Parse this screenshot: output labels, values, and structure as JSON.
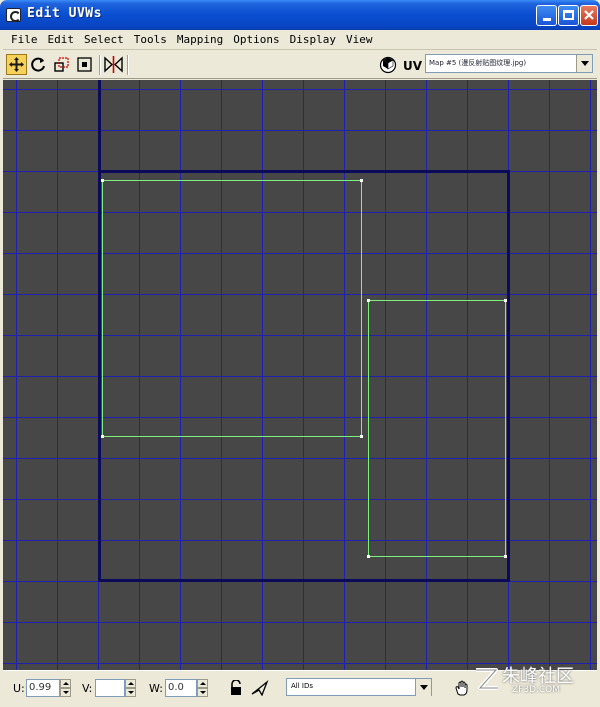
{
  "window": {
    "title": "Edit UVWs",
    "colors": {
      "titlebar": "#0a4fd0",
      "close": "#c4391b"
    }
  },
  "menu": {
    "items": [
      "File",
      "Edit",
      "Select",
      "Tools",
      "Mapping",
      "Options",
      "Display",
      "View"
    ]
  },
  "toolbar": {
    "tools": [
      "move-tool-icon",
      "rotate-tool-icon",
      "scale-tool-icon",
      "freeform-tool-icon",
      "mirror-tool-icon"
    ],
    "uv_label": "UV",
    "map_select_value": "Map #5 (漫反射贴图纹理.jpg)"
  },
  "viewport": {
    "colors": {
      "background": "#474747",
      "grid": "#2020b0",
      "uv_bounds": "#0b0b5a",
      "shell": "#7ef07e",
      "vertex": "#ffffff"
    }
  },
  "status": {
    "u_label": "U:",
    "u_value": "0.99",
    "v_label": "V:",
    "v_value": "",
    "w_label": "W:",
    "w_value": "0.0",
    "id_select_value": "All IDs"
  },
  "watermark": {
    "text": "朱峰社区",
    "sub": "ZF3D.COM"
  }
}
